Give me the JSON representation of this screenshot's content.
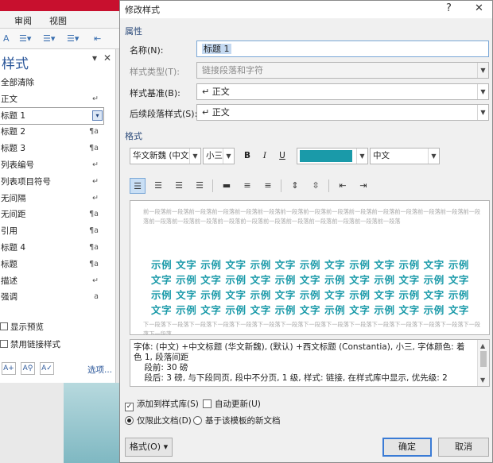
{
  "ribbon": {
    "tabs": [
      "审阅",
      "视图"
    ]
  },
  "styles_pane": {
    "title": "样式",
    "items": [
      {
        "label": "全部清除",
        "mark": ""
      },
      {
        "label": "正文",
        "mark": "↵"
      },
      {
        "label": "标题 1",
        "mark": "▾"
      },
      {
        "label": "标题 2",
        "mark": "¶a"
      },
      {
        "label": "标题 3",
        "mark": "¶a"
      },
      {
        "label": "列表编号",
        "mark": "↵"
      },
      {
        "label": "列表项目符号",
        "mark": "↵"
      },
      {
        "label": "无间隔",
        "mark": "↵"
      },
      {
        "label": "无间距",
        "mark": "¶a"
      },
      {
        "label": "引用",
        "mark": "¶a"
      },
      {
        "label": "标题 4",
        "mark": "¶a"
      },
      {
        "label": "标题",
        "mark": "¶a"
      },
      {
        "label": "描述",
        "mark": "↵"
      },
      {
        "label": "强调",
        "mark": "a"
      }
    ],
    "show_preview": "显示预览",
    "disable_linked": "禁用链接样式",
    "options_link": "选项..."
  },
  "dialog": {
    "title": "修改样式",
    "help": "?",
    "close": "✕",
    "properties_section": "属性",
    "name_label": "名称(N):",
    "name_value": "标题 1",
    "style_type_label": "样式类型(T):",
    "style_type_value": "链接段落和字符",
    "based_on_label": "样式基准(B):",
    "based_on_value": "↵ 正文",
    "following_label": "后续段落样式(S):",
    "following_value": "↵ 正文",
    "format_section": "格式",
    "font": "华文新魏 (中文",
    "size": "小三",
    "bold": "B",
    "italic": "I",
    "underline": "U",
    "font_color": "#1a9aa9",
    "language": "中文",
    "preview_before": "前一段落前一段落前一段落前一段落前一段落前一段落前一段落前一段落前一段落前一段落前一段落前一段落前一段落前一段落前一段落前一段落前一段落前一段落前一段落前一段落前一段落前一段落前一段落前一段落前一段落前一段落",
    "sample_lines": [
      "示例 文字 示例 文字 示例 文字 示例 文字 示例 文字 示例 文字 示例",
      "文字 示例 文字 示例 文字 示例 文字 示例 文字 示例 文字 示例 文字",
      "示例 文字 示例 文字 示例 文字 示例 文字 示例 文字 示例 文字 示例",
      "文字 示例 文字 示例 文字 示例 文字 示例 文字 示例 文字 示例 文字"
    ],
    "preview_after": "下一段落下一段落下一段落下一段落下一段落下一段落下一段落下一段落下一段落下一段落下一段落下一段落下一段落下一段落下一段落下一段落",
    "description": "字体: (中文) +中文标题 (华文新魏), (默认) +西文标题 (Constantia), 小三, 字体颜色: 着色 1, 段落间距\n    段前: 30 磅\n    段后: 3 磅, 与下段同页, 段中不分页, 1 级, 样式: 链接, 在样式库中显示, 优先级: 2",
    "add_to_gallery": "添加到样式库(S)",
    "auto_update": "自动更新(U)",
    "only_this_doc": "仅限此文档(D)",
    "new_docs_template": "基于该模板的新文档",
    "format_button": "格式(O) ▾",
    "ok": "确定",
    "cancel": "取消"
  }
}
